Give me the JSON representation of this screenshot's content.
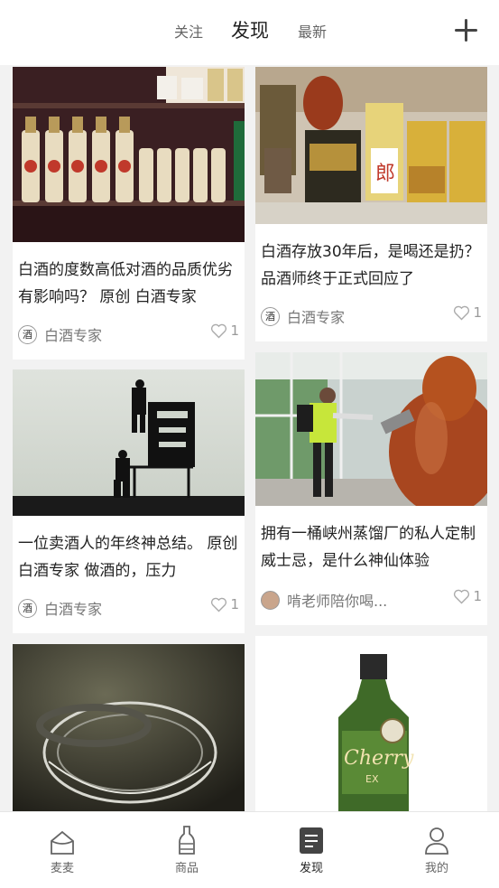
{
  "header": {
    "tabs": [
      {
        "label": "关注"
      },
      {
        "label": "发现"
      },
      {
        "label": "最新"
      }
    ]
  },
  "feed": {
    "cards": [
      {
        "title": "白酒的度数高低对酒的品质优劣有影响吗？ 原创 白酒专家",
        "author": "白酒专家",
        "avatar_text": "酒",
        "likes": "1"
      },
      {
        "title": "白酒存放30年后，是喝还是扔？品酒师终于正式回应了",
        "author": "白酒专家",
        "avatar_text": "酒",
        "likes": "1"
      },
      {
        "title": "一位卖酒人的年终神总结。 原创 白酒专家 做酒的，压力",
        "author": "白酒专家",
        "avatar_text": "酒",
        "likes": "1"
      },
      {
        "title": "拥有一桶峡州蒸馏厂的私人定制威士忌，是什么神仙体验",
        "author": "啃老师陪你喝...",
        "avatar_text": "",
        "likes": "1"
      },
      {
        "image": "glass"
      },
      {
        "image": "cherry-bottle",
        "bottle_label": "Cherry",
        "bottle_sub": "EX"
      }
    ]
  },
  "bottom_nav": {
    "items": [
      {
        "label": "麦麦",
        "icon": "home-icon"
      },
      {
        "label": "商品",
        "icon": "bottle-icon"
      },
      {
        "label": "发现",
        "icon": "document-icon"
      },
      {
        "label": "我的",
        "icon": "person-icon"
      }
    ]
  }
}
